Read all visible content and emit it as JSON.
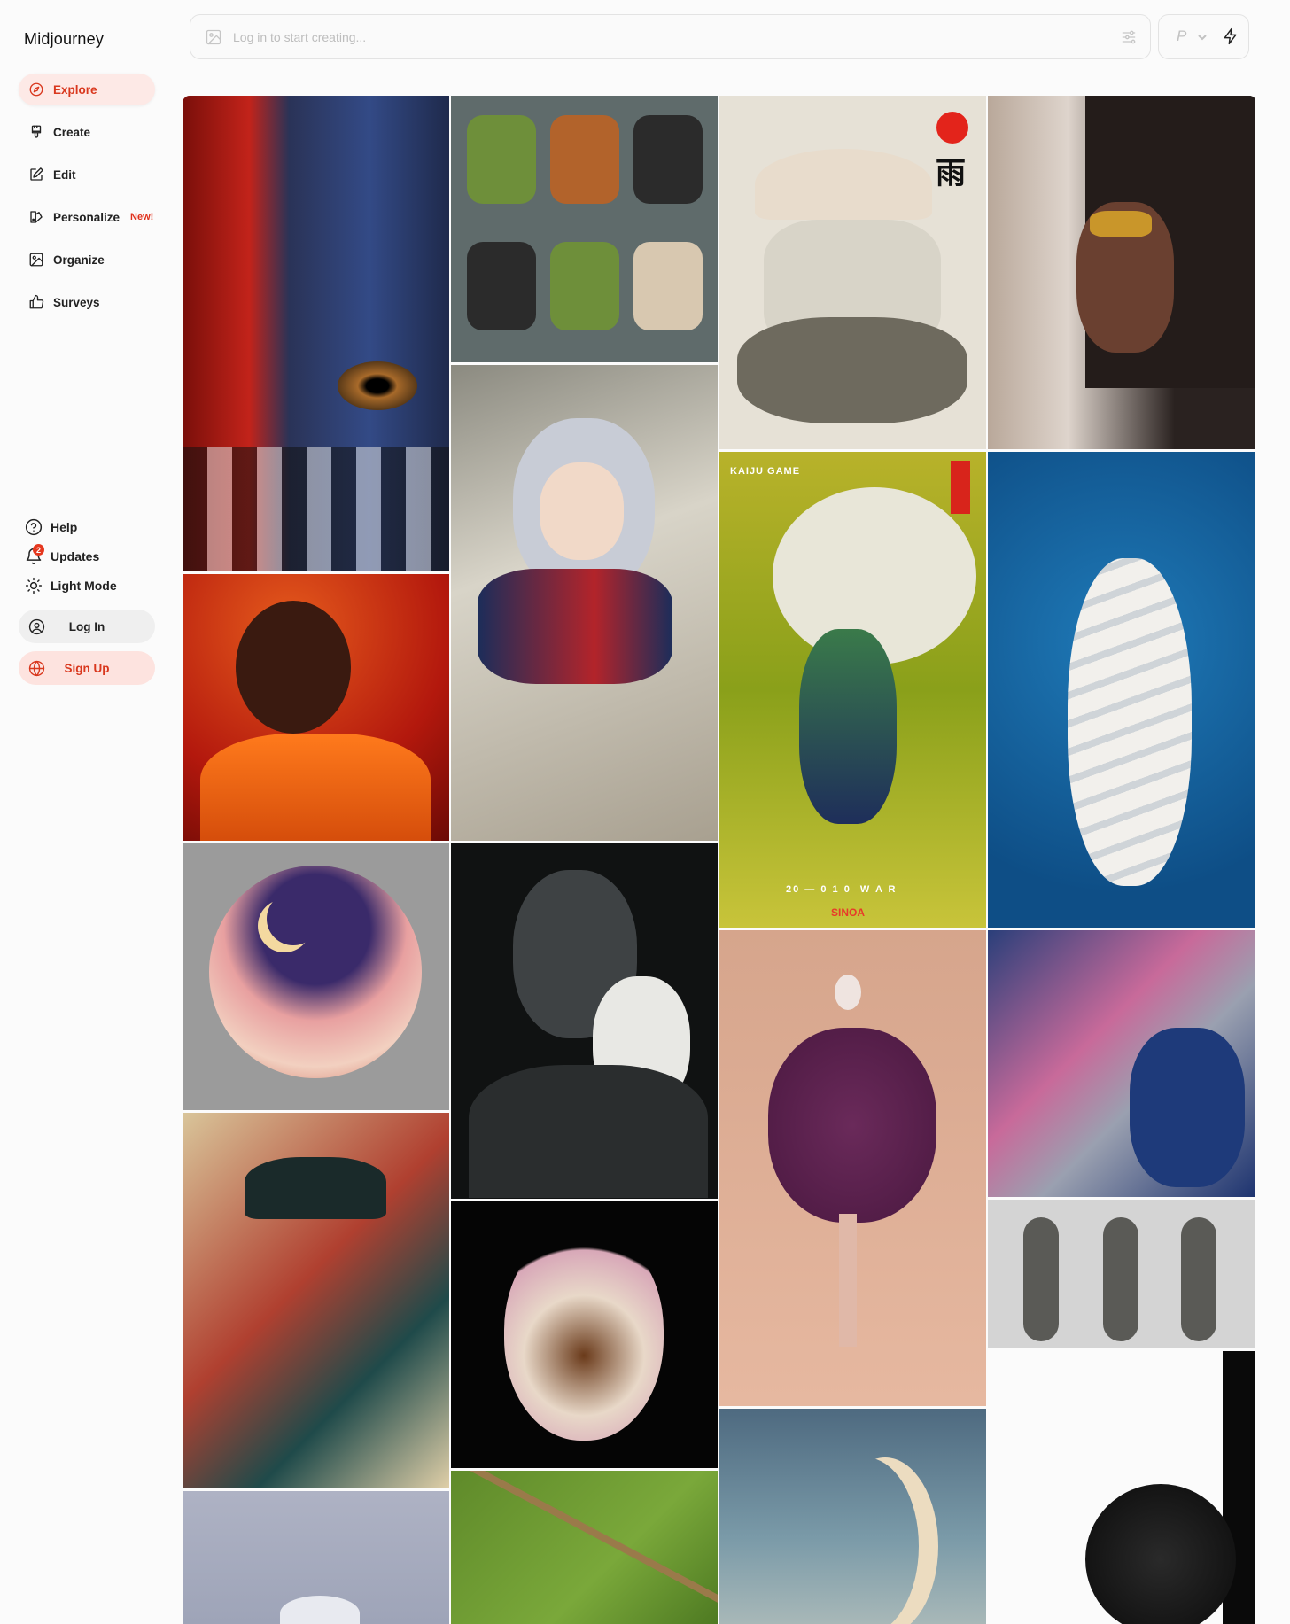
{
  "brand": {
    "name": "Midjourney"
  },
  "nav": {
    "explore": "Explore",
    "create": "Create",
    "edit": "Edit",
    "personalize": "Personalize",
    "personalize_badge": "New!",
    "organize": "Organize",
    "surveys": "Surveys"
  },
  "util": {
    "help": "Help",
    "updates": "Updates",
    "updates_count": "2",
    "light_mode": "Light Mode"
  },
  "auth": {
    "login": "Log In",
    "signup": "Sign Up"
  },
  "prompt": {
    "placeholder": "Log in to start creating..."
  },
  "mode": {
    "value": "P"
  },
  "poster_texts": {
    "kaiju_title": "KAIJU GAME",
    "kaiju_bottom": "20 — 0 1 0  W A R",
    "kaiju_brand": "SINOA",
    "samurai_glyph": "雨"
  },
  "colors": {
    "accent": "#d9381e",
    "accent_bg": "#fde9e6"
  }
}
